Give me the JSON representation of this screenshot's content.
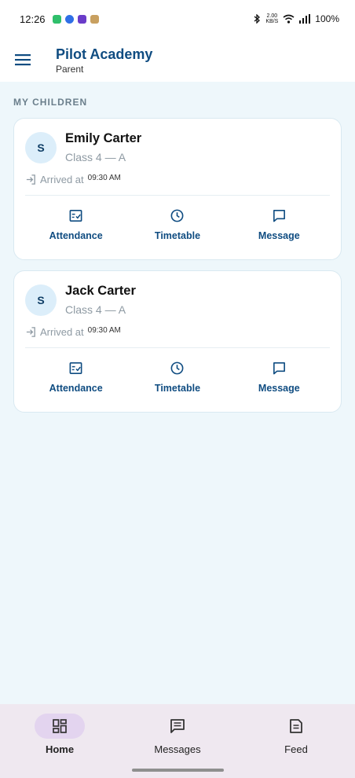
{
  "status_bar": {
    "time": "12:26",
    "net_speed_value": "2.00",
    "net_speed_unit": "KB/S",
    "battery": "100%",
    "app_icon_colors": [
      "#2fbf6b",
      "#2f6fe6",
      "#6a3cc9",
      "#c8a060"
    ]
  },
  "app_bar": {
    "title": "Pilot Academy",
    "subtitle": "Parent",
    "menu_icon": "menu-icon"
  },
  "section_label": "MY CHILDREN",
  "children": [
    {
      "initial": "S",
      "name": "Emily Carter",
      "class": "Class 4 — A",
      "arrival_label": "Arrived at",
      "arrival_time": "09:30 AM",
      "actions": [
        {
          "label": "Attendance",
          "icon": "attendance-icon"
        },
        {
          "label": "Timetable",
          "icon": "clock-icon"
        },
        {
          "label": "Message",
          "icon": "chat-icon"
        }
      ]
    },
    {
      "initial": "S",
      "name": "Jack Carter",
      "class": "Class 4 — A",
      "arrival_label": "Arrived at",
      "arrival_time": "09:30 AM",
      "actions": [
        {
          "label": "Attendance",
          "icon": "attendance-icon"
        },
        {
          "label": "Timetable",
          "icon": "clock-icon"
        },
        {
          "label": "Message",
          "icon": "chat-icon"
        }
      ]
    }
  ],
  "bottom_nav": {
    "items": [
      {
        "label": "Home",
        "icon": "dashboard-icon",
        "active": true
      },
      {
        "label": "Messages",
        "icon": "message-icon",
        "active": false
      },
      {
        "label": "Feed",
        "icon": "feed-icon",
        "active": false
      }
    ]
  },
  "colors": {
    "primary": "#0f4c81",
    "background": "#eef7fb",
    "nav_background": "#efe8f0",
    "nav_active_pill": "#e3d4ef",
    "avatar_bg": "#dceefa"
  }
}
